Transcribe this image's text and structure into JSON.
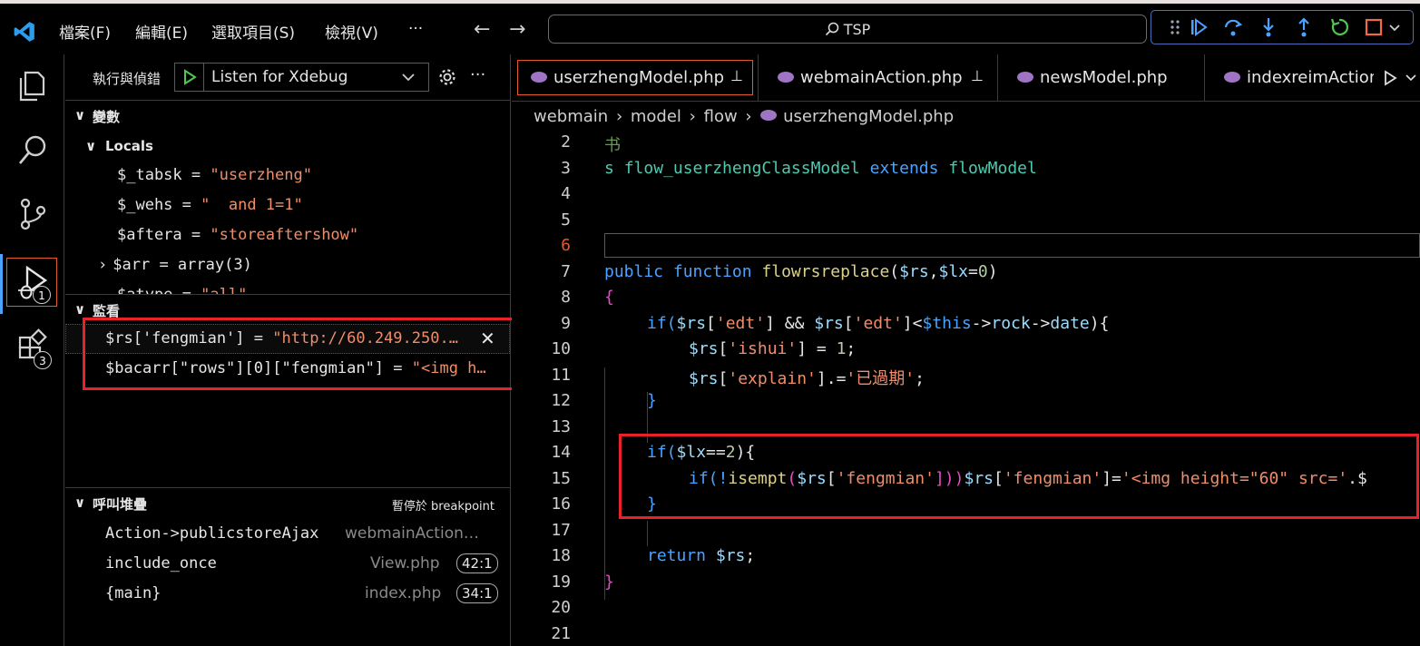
{
  "menubar": {
    "file": "檔案(F)",
    "edit": "編輯(E)",
    "selection": "選取項目(S)",
    "view": "檢視(V)",
    "more": "···"
  },
  "search": {
    "text": "TSP"
  },
  "sidebar": {
    "run_label": "執行與偵錯",
    "config": "Listen for Xdebug",
    "variables_title": "變數",
    "locals_title": "Locals",
    "locals": [
      {
        "name": "$_tabsk",
        "eq": " = ",
        "value": "\"userzheng\""
      },
      {
        "name": "$_wehs",
        "eq": " = ",
        "value": "\"  and 1=1\""
      },
      {
        "name": "$aftera",
        "eq": " = ",
        "value": "\"storeaftershow\""
      },
      {
        "name": "$arr",
        "eq": " = ",
        "value": "array(3)"
      },
      {
        "name": "$atype",
        "eq": " = ",
        "value": "\"all\""
      }
    ],
    "watch_title": "監看",
    "watch": [
      {
        "expr": "$rs['fengmian']",
        "eq": " = ",
        "value": "\"http://60.249.250.…"
      },
      {
        "expr": "$bacarr[\"rows\"][0][\"fengmian\"]",
        "eq": " = ",
        "value": "\"<img h…"
      }
    ],
    "callstack_title": "呼叫堆疊",
    "paused_text": "暫停於 breakpoint",
    "frames": [
      {
        "name": "Action->publicstoreAjax",
        "file": "webmainAction…",
        "pos": ""
      },
      {
        "name": "include_once",
        "file": "View.php",
        "pos": "42:1"
      },
      {
        "name": "{main}",
        "file": "index.php",
        "pos": "34:1"
      }
    ]
  },
  "activity": {
    "run_badge": "1",
    "ext_badge": "3"
  },
  "tabs": [
    {
      "label": "userzhengModel.php",
      "pinned": true
    },
    {
      "label": "webmainAction.php",
      "pinned": true
    },
    {
      "label": "newsModel.php",
      "pinned": false
    },
    {
      "label": "indexreimAction",
      "pinned": false
    }
  ],
  "breadcrumb": {
    "a": "webmain",
    "b": "model",
    "c": "flow",
    "d": "userzhengModel.php"
  },
  "code": {
    "line_numbers": [
      "2",
      "3",
      "4",
      "5",
      "6",
      "7",
      "8",
      "9",
      "10",
      "11",
      "12",
      "13",
      "14",
      "15",
      "16",
      "17",
      "18",
      "19",
      "20",
      "21"
    ],
    "l2": "书",
    "l3_a": "s ",
    "l3_b": "flow_userzhengClassModel",
    "l3_c": " extends ",
    "l3_d": "flowModel",
    "l7_a": "public ",
    "l7_b": "function ",
    "l7_c": "flowrsreplace",
    "l7_d": "(",
    "l7_e": "$rs",
    "l7_f": ",",
    "l7_g": "$lx",
    "l7_h": "=",
    "l7_i": "0",
    "l7_j": ")",
    "l8": "{",
    "l9_a": "if(",
    "l9_b": "$rs",
    "l9_c": "[",
    "l9_d": "'edt'",
    "l9_e": "] && ",
    "l9_f": "$rs",
    "l9_g": "[",
    "l9_h": "'edt'",
    "l9_i": "]<",
    "l9_j": "$this",
    "l9_k": "->",
    "l9_l": "rock",
    "l9_m": "->",
    "l9_n": "date",
    "l9_o": "){",
    "l10_a": "$rs",
    "l10_b": "[",
    "l10_c": "'ishui'",
    "l10_d": "] = ",
    "l10_e": "1",
    "l10_f": ";",
    "l11_a": "$rs",
    "l11_b": "[",
    "l11_c": "'explain'",
    "l11_d": "].=",
    "l11_e": "'已過期'",
    "l11_f": ";",
    "l12": "}",
    "l14_a": "if(",
    "l14_b": "$lx",
    "l14_c": "==",
    "l14_d": "2",
    "l14_e": "){",
    "l15_a": "if(!",
    "l15_b": "isempt",
    "l15_c": "(",
    "l15_d": "$rs",
    "l15_e": "[",
    "l15_f": "'fengmian'",
    "l15_g": "]))",
    "l15_h": "$rs",
    "l15_i": "[",
    "l15_j": "'fengmian'",
    "l15_k": "]=",
    "l15_l": "'<img height=\"60\" src='",
    "l15_m": ".$",
    "l16": "}",
    "l18_a": "return ",
    "l18_b": "$rs",
    "l18_c": ";",
    "l19": "}"
  }
}
